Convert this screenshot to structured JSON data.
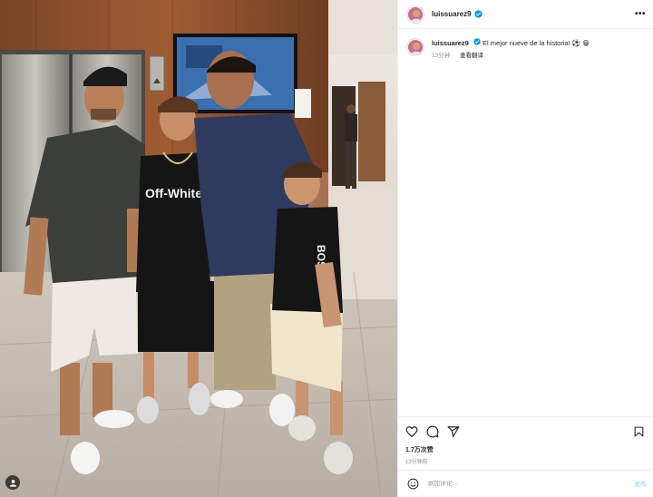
{
  "post": {
    "username": "luissuarez9",
    "caption_text": "El mejor nueve de la historia! ⚽ 😁",
    "caption_time": "13分钟",
    "translate_label": "查看翻译",
    "likes": "1.7万次赞",
    "timestamp": "13分钟前",
    "comment_placeholder": "添加评论...",
    "post_label": "发布",
    "more_label": "•••"
  },
  "photo": {
    "shirt_text_left": "Off-White",
    "shirt_text_right": "BOSS"
  },
  "colors": {
    "verified": "#0095f6",
    "post_button": "#b2dffc",
    "secondary_text": "#8e8e8e"
  },
  "icons": [
    "more-icon",
    "verified-icon",
    "heart-icon",
    "comment-icon",
    "share-icon",
    "bookmark-icon",
    "emoji-icon",
    "user-tag-icon"
  ]
}
